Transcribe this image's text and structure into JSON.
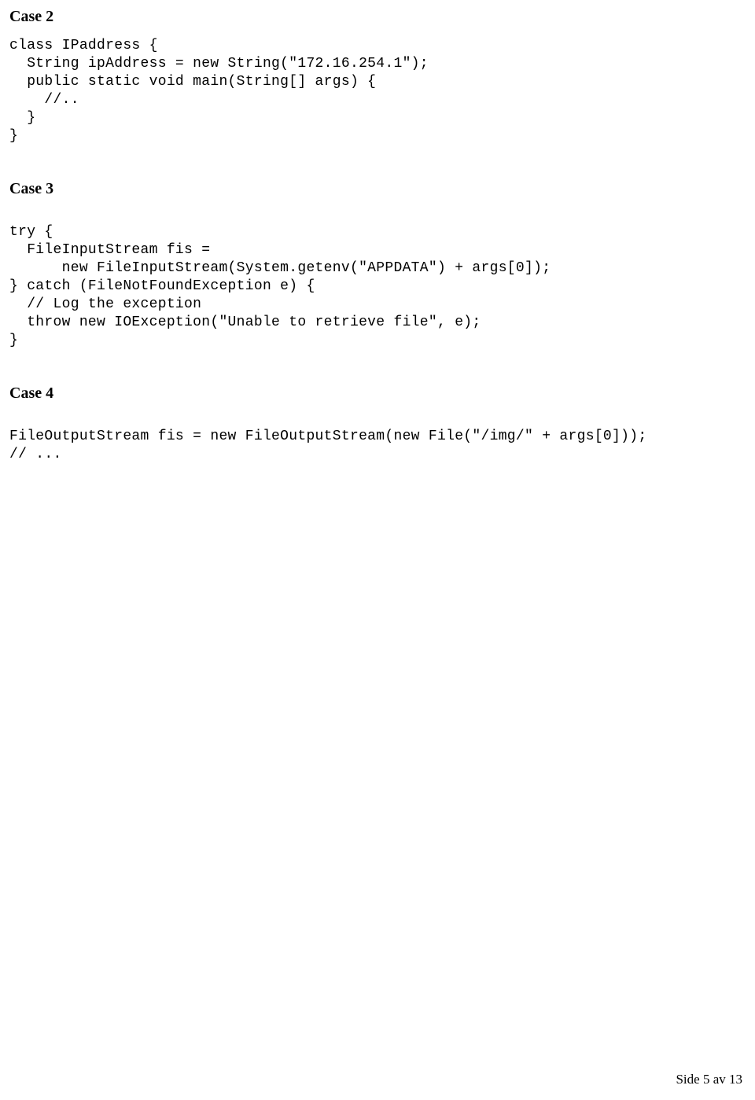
{
  "sections": [
    {
      "heading": "Case 2",
      "code": "class IPaddress {\n  String ipAddress = new String(\"172.16.254.1\");\n  public static void main(String[] args) {\n    //..\n  }\n}"
    },
    {
      "heading": "Case 3",
      "code": "try {\n  FileInputStream fis =\n      new FileInputStream(System.getenv(\"APPDATA\") + args[0]);\n} catch (FileNotFoundException e) {\n  // Log the exception\n  throw new IOException(\"Unable to retrieve file\", e);\n}"
    },
    {
      "heading": "Case 4",
      "code": "FileOutputStream fis = new FileOutputStream(new File(\"/img/\" + args[0]));\n// ..."
    }
  ],
  "footer": "Side 5 av 13"
}
